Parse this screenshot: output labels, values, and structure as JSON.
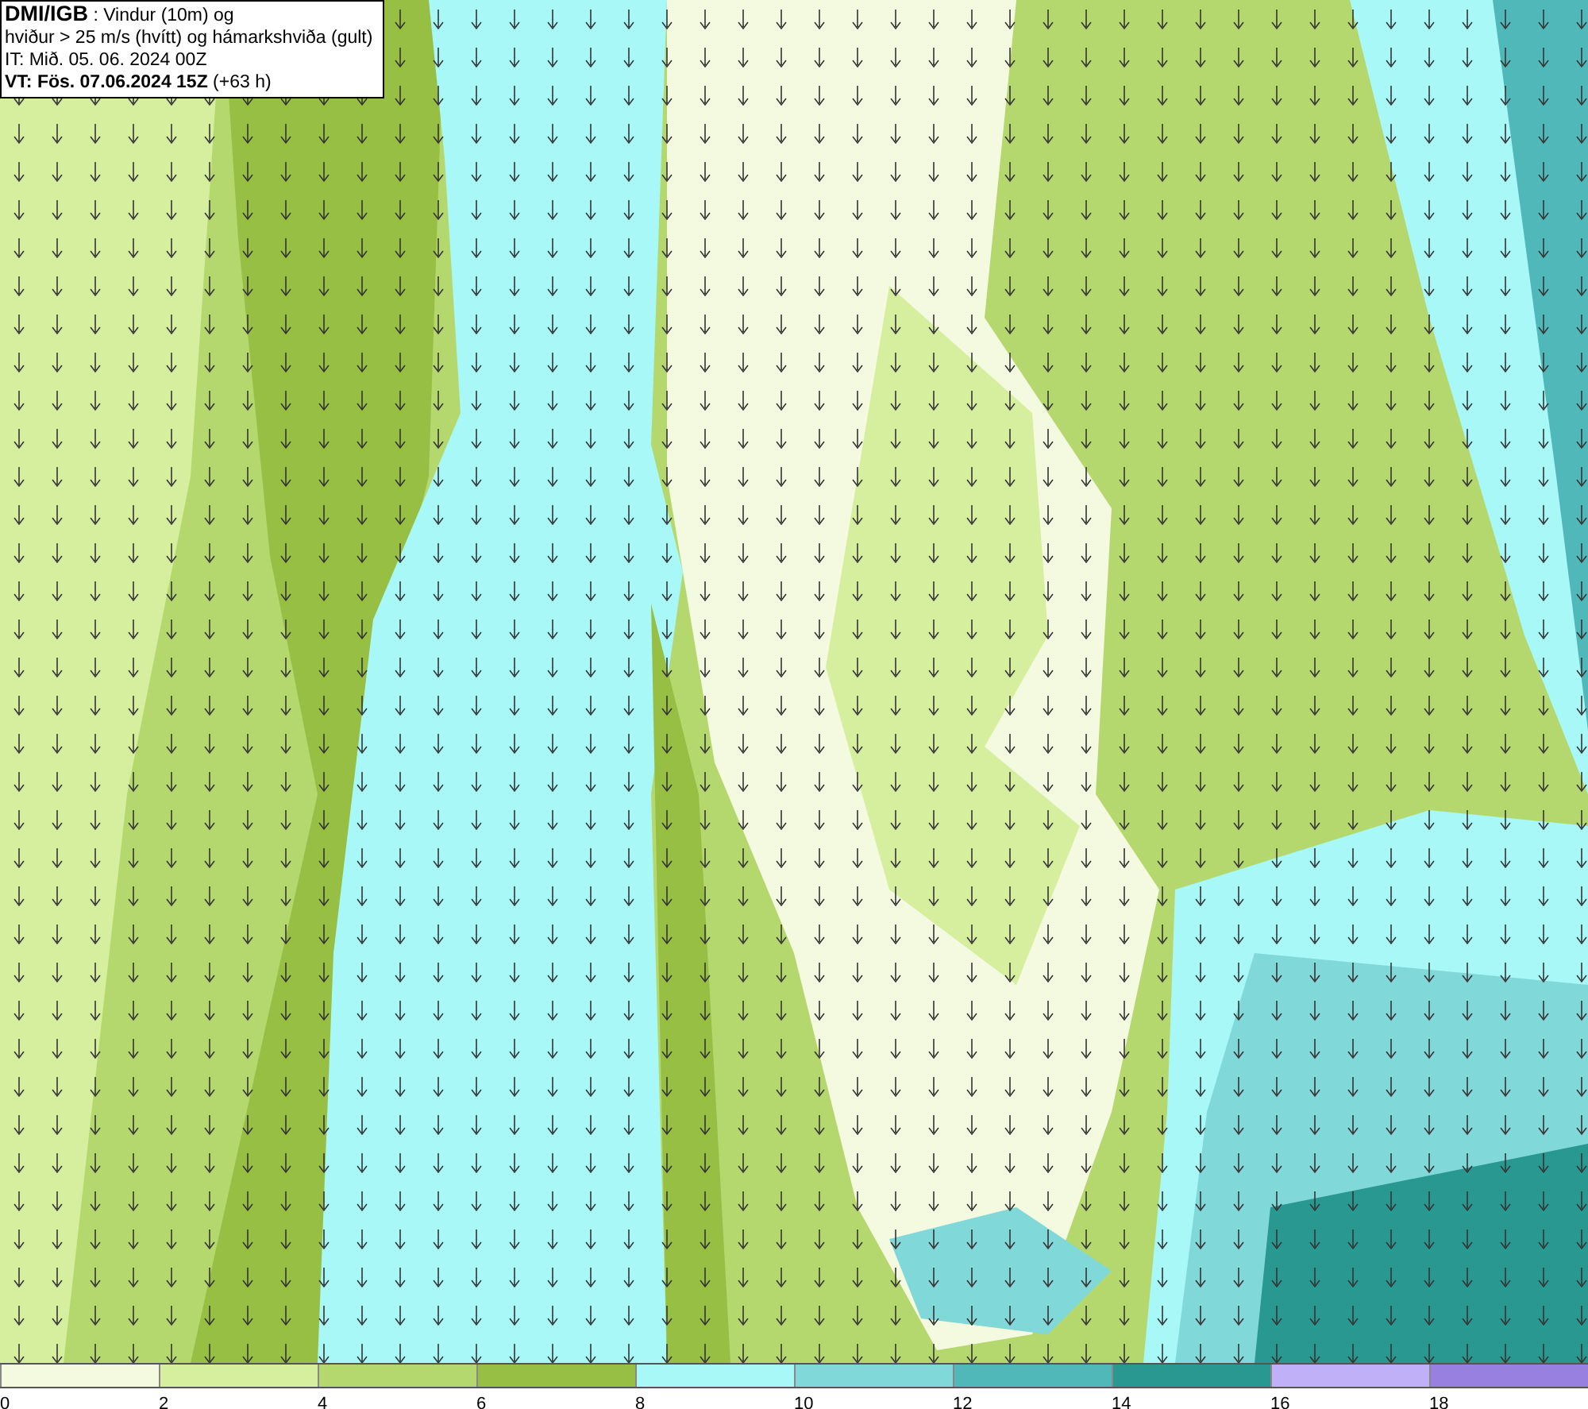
{
  "title_box": {
    "lines": [
      "**DMI/IGB** : Vindur (10m) og",
      "hviður > 25 m/s (hvítt) og hámarkshviða (gult)",
      "IT: Mið. 05. 06. 2024 00Z",
      "**VT: Fös. 07.06.2024 15Z** (+63 h)"
    ]
  },
  "legend": [
    {
      "label": "0",
      "color": "#f4fadf"
    },
    {
      "label": "2",
      "color": "#d5ef9f"
    },
    {
      "label": "4",
      "color": "#b5d86e"
    },
    {
      "label": "6",
      "color": "#97bf44"
    },
    {
      "label": "8",
      "color": "#a8f8f8"
    },
    {
      "label": "10",
      "color": "#80d8d8"
    },
    {
      "label": "12",
      "color": "#50b8b8"
    },
    {
      "label": "14",
      "color": "#289890"
    },
    {
      "label": "16",
      "color": "#c0b0f8"
    },
    {
      "label": "18",
      "color": "#9880e0"
    }
  ]
}
